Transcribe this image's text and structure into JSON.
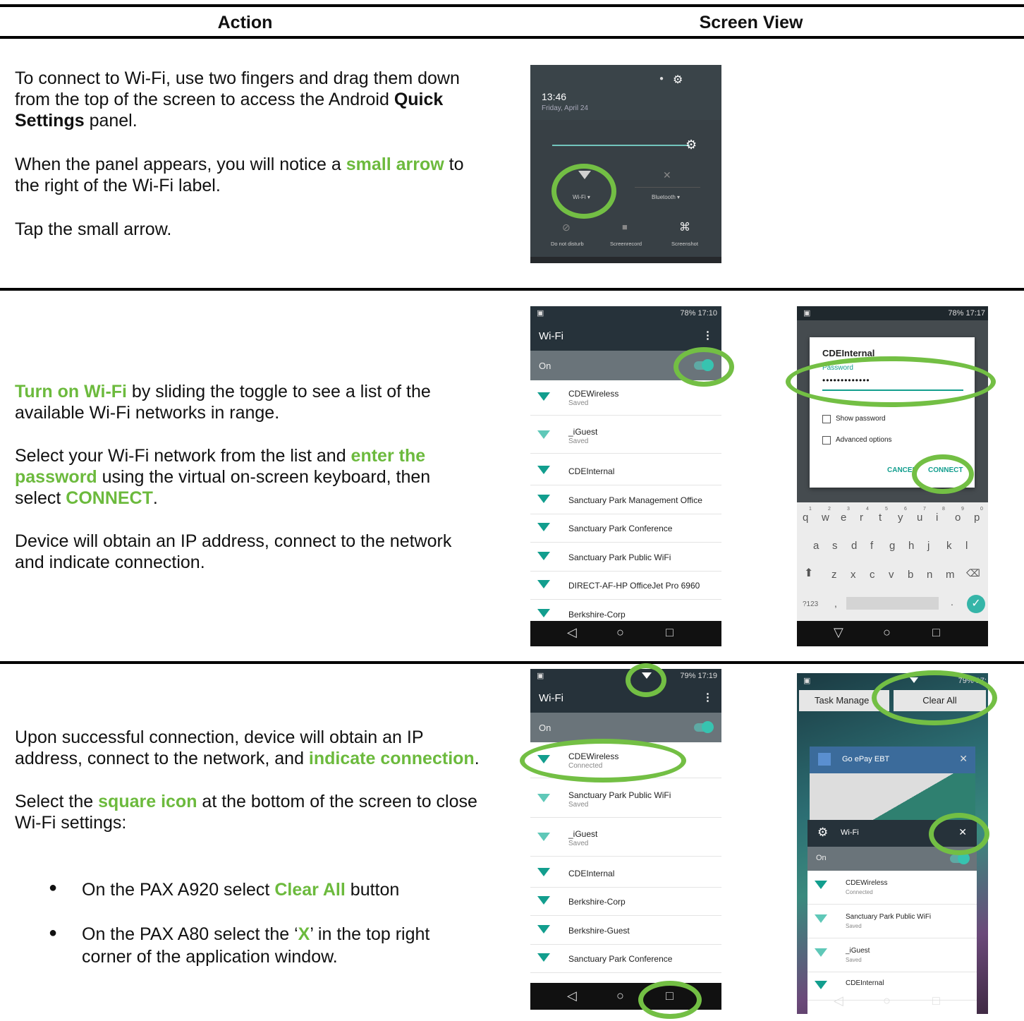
{
  "header": {
    "col_action": "Action",
    "col_screen": "Screen View"
  },
  "row1": {
    "p1_a": "To connect to Wi-Fi, use two fingers and drag them down from the top of the screen to access the Android ",
    "p1_b": "Quick Settings",
    "p1_c": " panel.",
    "p2_a": "When the panel appears, you will notice a ",
    "p2_b": "small arrow",
    "p2_c": " to the right of the Wi-Fi label.",
    "p3": "Tap the small arrow."
  },
  "row2": {
    "p1_a": "Turn on Wi-Fi",
    "p1_b": " by sliding the toggle to see a list of the available Wi-Fi networks in range.",
    "p2_a": "Select your Wi-Fi network from the list and ",
    "p2_b": "enter the password",
    "p2_c": " using the virtual on-screen keyboard, then select ",
    "p2_d": "CONNECT",
    "p2_e": ".",
    "p3": "Device will obtain an IP address, connect to the network and indicate connection."
  },
  "row3": {
    "p1_a": "Upon successful connection, device will obtain an IP address, connect to the network, and ",
    "p1_b": "indicate connection",
    "p1_c": ".",
    "p2_a": "Select the ",
    "p2_b": "square icon",
    "p2_c": " at the bottom of the screen to close Wi-Fi settings:",
    "b1_a": "On the PAX A920 select ",
    "b1_b": "Clear All",
    "b1_c": " button",
    "b2_a": "On the PAX A80 select the ‘",
    "b2_b": "X",
    "b2_c": "’ in the top right corner of the application window."
  },
  "quick_settings": {
    "time": "13:46",
    "date": "Friday, April 24",
    "tiles": [
      "Wi-Fi",
      "Bluetooth",
      "Do not disturb",
      "Screenrecord",
      "Screenshot"
    ]
  },
  "wifi_list_1": {
    "status": "78% 17:10",
    "title": "Wi-Fi",
    "on_label": "On",
    "networks": [
      {
        "name": "CDEWireless",
        "status": "Saved"
      },
      {
        "name": "_iGuest",
        "status": "Saved"
      },
      {
        "name": "CDEInternal",
        "status": ""
      },
      {
        "name": "Sanctuary Park Management Office",
        "status": ""
      },
      {
        "name": "Sanctuary  Park  Conference",
        "status": ""
      },
      {
        "name": "Sanctuary Park Public WiFi",
        "status": ""
      },
      {
        "name": "DIRECT-AF-HP OfficeJet Pro 6960",
        "status": ""
      },
      {
        "name": "Berkshire-Corp",
        "status": ""
      }
    ]
  },
  "password_dialog": {
    "status": "78% 17:17",
    "title": "CDEInternal",
    "field_label": "Password",
    "password_value": "•••••••••••••",
    "show_password": "Show password",
    "advanced": "Advanced options",
    "cancel": "CANCEL",
    "connect": "CONNECT",
    "keys_row1": [
      "q",
      "w",
      "e",
      "r",
      "t",
      "y",
      "u",
      "i",
      "o",
      "p"
    ],
    "keys_nums": [
      "1",
      "2",
      "3",
      "4",
      "5",
      "6",
      "7",
      "8",
      "9",
      "0"
    ],
    "keys_row2": [
      "a",
      "s",
      "d",
      "f",
      "g",
      "h",
      "j",
      "k",
      "l"
    ],
    "keys_row3": [
      "z",
      "x",
      "c",
      "v",
      "b",
      "n",
      "m"
    ],
    "key_sym": "?123",
    "key_comma": ",",
    "key_period": "."
  },
  "wifi_list_2": {
    "status": "79% 17:19",
    "title": "Wi-Fi",
    "on_label": "On",
    "networks": [
      {
        "name": "CDEWireless",
        "status": "Connected"
      },
      {
        "name": "Sanctuary Park Public WiFi",
        "status": "Saved"
      },
      {
        "name": "_iGuest",
        "status": "Saved"
      },
      {
        "name": "CDEInternal",
        "status": ""
      },
      {
        "name": "Berkshire-Corp",
        "status": ""
      },
      {
        "name": "Berkshire-Guest",
        "status": ""
      },
      {
        "name": "Sanctuary  Park  Conference",
        "status": ""
      }
    ]
  },
  "task_manager": {
    "status": "79% 17:",
    "task_label": "Task Manage",
    "clear_all": "Clear All",
    "card1_title": "Go ePay EBT",
    "card2_title": "Wi-Fi",
    "on_label": "On",
    "networks": [
      {
        "name": "CDEWireless",
        "status": "Connected"
      },
      {
        "name": "Sanctuary Park Public WiFi",
        "status": "Saved"
      },
      {
        "name": "_iGuest",
        "status": "Saved"
      },
      {
        "name": "CDEInternal",
        "status": ""
      }
    ]
  },
  "colors": {
    "accent_green": "#6cba3d",
    "ring_green": "#73bf44",
    "teal": "#129e8e"
  }
}
